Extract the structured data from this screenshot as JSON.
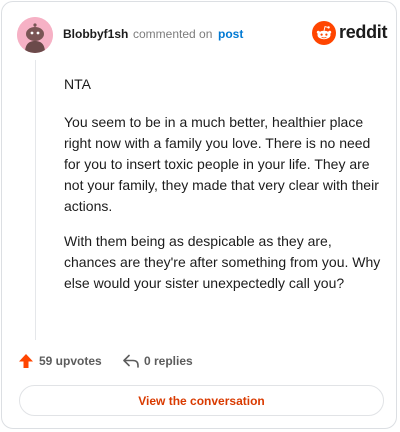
{
  "header": {
    "username": "Blobbyf1sh",
    "commented_on": "commented on",
    "post_link": "post",
    "brand": "reddit",
    "brand_color": "#ff4500",
    "avatar_color": "#f6b1c5"
  },
  "comment": {
    "paragraphs": [
      "NTA",
      "You seem to be in a much better, healthier place right now with a family you love. There is no need for you to insert toxic people in your life. They are not your family, they made that very clear with their actions.",
      "With them being as despicable as they are, chances are they're after something from you. Why else would your sister unexpectedly call you?"
    ]
  },
  "actions": {
    "upvotes": "59 upvotes",
    "replies": "0 replies",
    "upvote_icon": "upvote-arrow-icon",
    "reply_icon": "reply-arrow-icon",
    "upvote_color": "#ff4500"
  },
  "footer": {
    "view_conversation": "View the conversation",
    "button_text_color": "#d93a00"
  }
}
